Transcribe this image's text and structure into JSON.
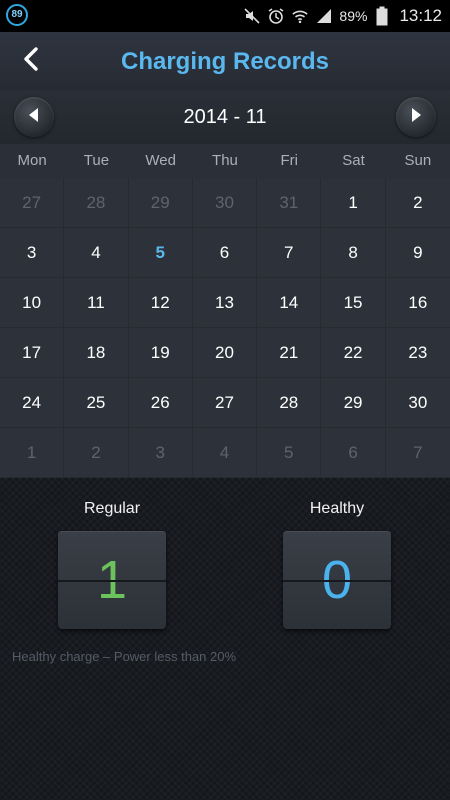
{
  "status_bar": {
    "badge": "89",
    "battery": "89%",
    "time": "13:12",
    "icons": [
      "mute-icon",
      "alarm-icon",
      "wifi-icon",
      "signal-icon",
      "battery-icon"
    ]
  },
  "header": {
    "title": "Charging Records",
    "back_icon": "chevron-left-icon"
  },
  "month_nav": {
    "label": "2014 - 11",
    "prev_icon": "triangle-left-icon",
    "next_icon": "triangle-right-icon"
  },
  "weekdays": [
    "Mon",
    "Tue",
    "Wed",
    "Thu",
    "Fri",
    "Sat",
    "Sun"
  ],
  "calendar": {
    "today": "5",
    "weeks": [
      [
        {
          "d": "27",
          "m": true
        },
        {
          "d": "28",
          "m": true
        },
        {
          "d": "29",
          "m": true
        },
        {
          "d": "30",
          "m": true
        },
        {
          "d": "31",
          "m": true
        },
        {
          "d": "1"
        },
        {
          "d": "2"
        }
      ],
      [
        {
          "d": "3"
        },
        {
          "d": "4"
        },
        {
          "d": "5",
          "t": true
        },
        {
          "d": "6"
        },
        {
          "d": "7"
        },
        {
          "d": "8"
        },
        {
          "d": "9"
        }
      ],
      [
        {
          "d": "10"
        },
        {
          "d": "11"
        },
        {
          "d": "12"
        },
        {
          "d": "13"
        },
        {
          "d": "14"
        },
        {
          "d": "15"
        },
        {
          "d": "16"
        }
      ],
      [
        {
          "d": "17"
        },
        {
          "d": "18"
        },
        {
          "d": "19"
        },
        {
          "d": "20"
        },
        {
          "d": "21"
        },
        {
          "d": "22"
        },
        {
          "d": "23"
        }
      ],
      [
        {
          "d": "24"
        },
        {
          "d": "25"
        },
        {
          "d": "26"
        },
        {
          "d": "27"
        },
        {
          "d": "28"
        },
        {
          "d": "29"
        },
        {
          "d": "30"
        }
      ],
      [
        {
          "d": "1",
          "m": true
        },
        {
          "d": "2",
          "m": true
        },
        {
          "d": "3",
          "m": true
        },
        {
          "d": "4",
          "m": true
        },
        {
          "d": "5",
          "m": true
        },
        {
          "d": "6",
          "m": true
        },
        {
          "d": "7",
          "m": true
        }
      ]
    ]
  },
  "stats": {
    "regular_label": "Regular",
    "regular_value": "1",
    "healthy_label": "Healthy",
    "healthy_value": "0"
  },
  "note": "Healthy charge – Power less than 20%",
  "colors": {
    "accent": "#5ab8ef",
    "regular_value": "#6cc35b",
    "healthy_value": "#4ab3ee"
  }
}
